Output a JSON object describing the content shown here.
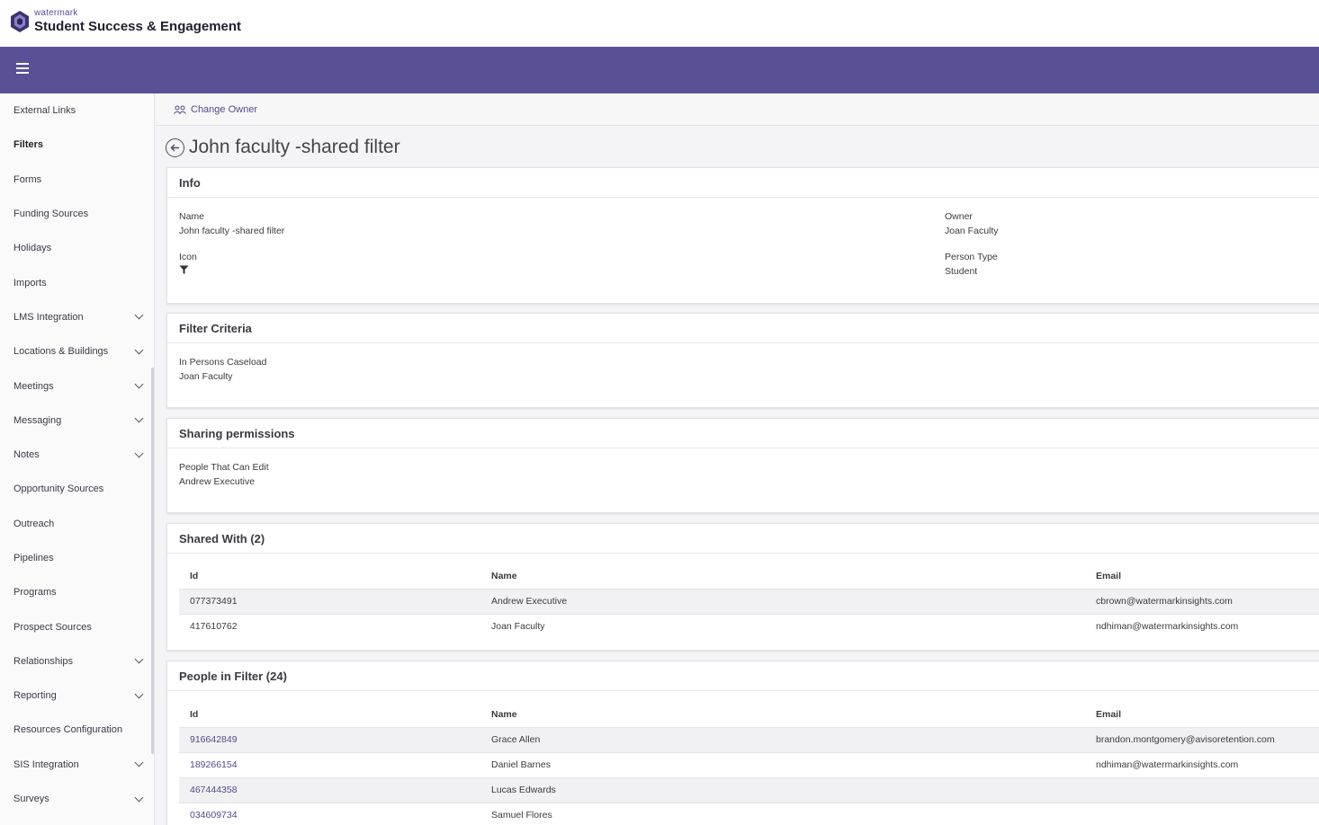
{
  "brand": {
    "small": "watermark",
    "big": "Student Success & Engagement"
  },
  "sidebar": {
    "items": [
      {
        "label": "External Links",
        "expandable": false
      },
      {
        "label": "Filters",
        "expandable": false,
        "active": true
      },
      {
        "label": "Forms",
        "expandable": false
      },
      {
        "label": "Funding Sources",
        "expandable": false
      },
      {
        "label": "Holidays",
        "expandable": false
      },
      {
        "label": "Imports",
        "expandable": false
      },
      {
        "label": "LMS Integration",
        "expandable": true
      },
      {
        "label": "Locations & Buildings",
        "expandable": true
      },
      {
        "label": "Meetings",
        "expandable": true
      },
      {
        "label": "Messaging",
        "expandable": true
      },
      {
        "label": "Notes",
        "expandable": true
      },
      {
        "label": "Opportunity Sources",
        "expandable": false
      },
      {
        "label": "Outreach",
        "expandable": false
      },
      {
        "label": "Pipelines",
        "expandable": false
      },
      {
        "label": "Programs",
        "expandable": false
      },
      {
        "label": "Prospect Sources",
        "expandable": false
      },
      {
        "label": "Relationships",
        "expandable": true
      },
      {
        "label": "Reporting",
        "expandable": true
      },
      {
        "label": "Resources Configuration",
        "expandable": false
      },
      {
        "label": "SIS Integration",
        "expandable": true
      },
      {
        "label": "Surveys",
        "expandable": true
      }
    ]
  },
  "actions": {
    "change_owner": "Change Owner"
  },
  "page": {
    "title": "John faculty -shared filter"
  },
  "info": {
    "heading": "Info",
    "name_label": "Name",
    "name_value": "John faculty -shared filter",
    "icon_label": "Icon",
    "icon_name": "filter-icon",
    "owner_label": "Owner",
    "owner_value": "Joan Faculty",
    "person_type_label": "Person Type",
    "person_type_value": "Student"
  },
  "criteria": {
    "heading": "Filter Criteria",
    "label": "In Persons Caseload",
    "value": "Joan Faculty"
  },
  "sharing": {
    "heading": "Sharing permissions",
    "label": "People That Can Edit",
    "value": "Andrew Executive"
  },
  "shared_with": {
    "heading": "Shared With (2)",
    "columns": [
      "Id",
      "Name",
      "Email"
    ],
    "rows": [
      [
        "077373491",
        "Andrew Executive",
        "cbrown@watermarkinsights.com"
      ],
      [
        "417610762",
        "Joan Faculty",
        "ndhiman@watermarkinsights.com"
      ]
    ]
  },
  "people": {
    "heading": "People in Filter (24)",
    "columns": [
      "Id",
      "Name",
      "Email"
    ],
    "rows": [
      [
        "916642849",
        "Grace Allen",
        "brandon.montgomery@avisoretention.com"
      ],
      [
        "189266154",
        "Daniel Barnes",
        "ndhiman@watermarkinsights.com"
      ],
      [
        "467444358",
        "Lucas Edwards",
        ""
      ],
      [
        "034609734",
        "Samuel Flores",
        ""
      ]
    ]
  },
  "colors": {
    "accent": "#585196",
    "link": "#4f4a8a"
  }
}
